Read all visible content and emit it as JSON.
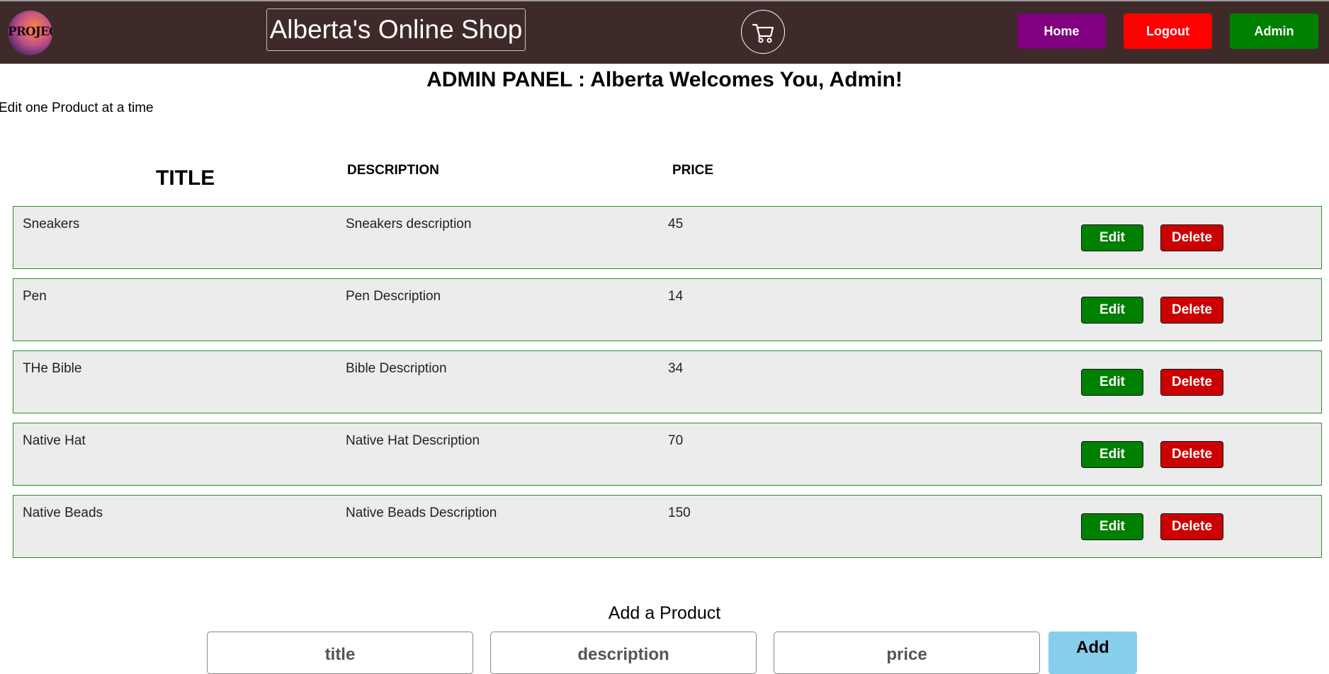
{
  "header": {
    "logo_text": "PROJECT",
    "brand": "Alberta's Online Shop",
    "nav": {
      "home": "Home",
      "logout": "Logout",
      "admin": "Admin"
    },
    "colors": {
      "bar": "#3f2a2a",
      "home": "#800080",
      "logout": "#ff0000",
      "admin": "#008000"
    }
  },
  "panel": {
    "title": "ADMIN PANEL : Alberta Welcomes You, Admin!",
    "subtitle": "Edit one Product at a time"
  },
  "table": {
    "headers": {
      "title": "TITLE",
      "description": "DESCRIPTION",
      "price": "PRICE"
    },
    "rows": [
      {
        "title": "Sneakers",
        "description": "Sneakers description",
        "price": "45"
      },
      {
        "title": "Pen",
        "description": "Pen Description",
        "price": "14"
      },
      {
        "title": "THe Bible",
        "description": "Bible Description",
        "price": "34"
      },
      {
        "title": "Native Hat",
        "description": "Native Hat Description",
        "price": "70"
      },
      {
        "title": "Native Beads",
        "description": "Native Beads Description",
        "price": "150"
      }
    ],
    "edit_label": "Edit",
    "delete_label": "Delete"
  },
  "add_form": {
    "heading": "Add a Product",
    "title_placeholder": "title",
    "description_placeholder": "description",
    "price_placeholder": "price",
    "add_label": "Add"
  }
}
